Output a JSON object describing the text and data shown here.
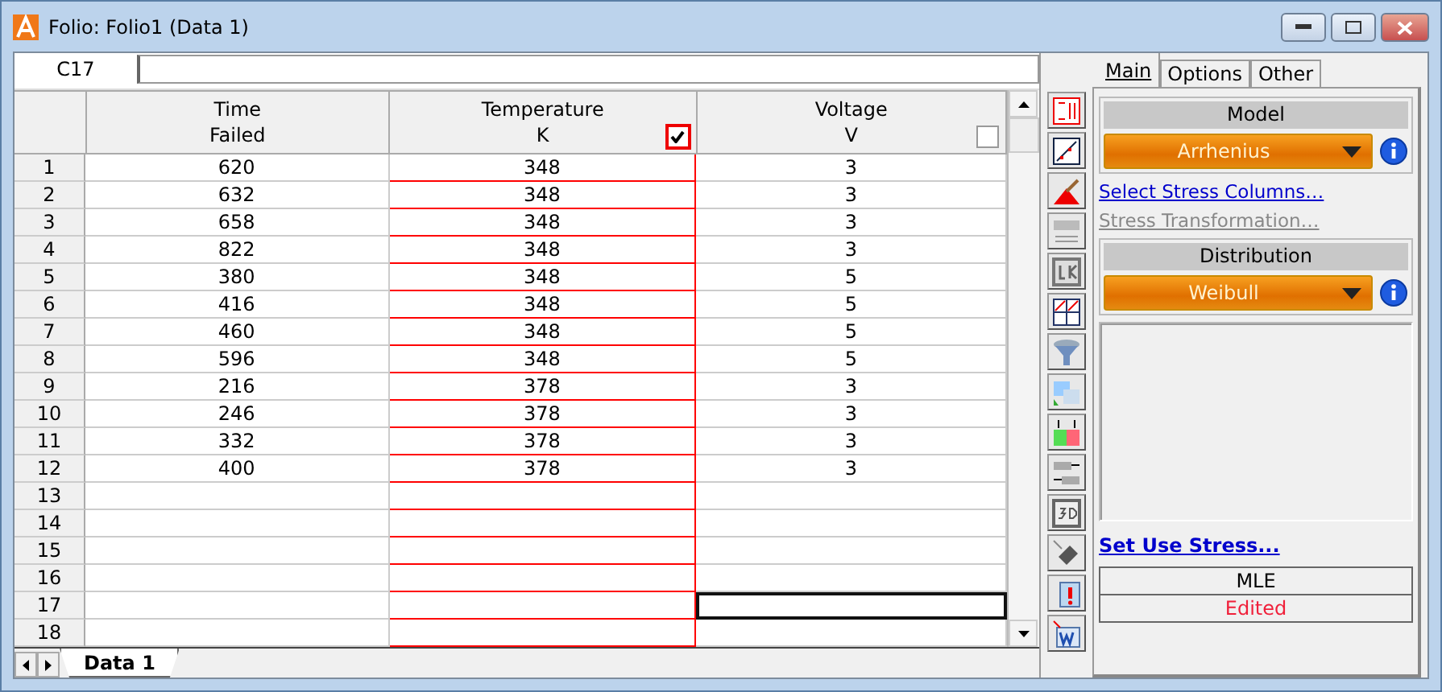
{
  "window": {
    "title": "Folio: Folio1 (Data 1)"
  },
  "cell_ref": "C17",
  "columns": [
    {
      "line1": "Time",
      "line2": "Failed"
    },
    {
      "line1": "Temperature",
      "line2": "K",
      "checked": true
    },
    {
      "line1": "Voltage",
      "line2": "V",
      "checked": false
    }
  ],
  "rows": [
    {
      "number": "1",
      "cells": [
        {
          "value": "620",
          "selected": false
        },
        {
          "value": "348",
          "selected": false
        },
        {
          "value": "3",
          "selected": false
        }
      ]
    },
    {
      "number": "2",
      "cells": [
        {
          "value": "632",
          "selected": false
        },
        {
          "value": "348",
          "selected": false
        },
        {
          "value": "3",
          "selected": false
        }
      ]
    },
    {
      "number": "3",
      "cells": [
        {
          "value": "658",
          "selected": false
        },
        {
          "value": "348",
          "selected": false
        },
        {
          "value": "3",
          "selected": false
        }
      ]
    },
    {
      "number": "4",
      "cells": [
        {
          "value": "822",
          "selected": false
        },
        {
          "value": "348",
          "selected": false
        },
        {
          "value": "3",
          "selected": false
        }
      ]
    },
    {
      "number": "5",
      "cells": [
        {
          "value": "380",
          "selected": false
        },
        {
          "value": "348",
          "selected": false
        },
        {
          "value": "5",
          "selected": false
        }
      ]
    },
    {
      "number": "6",
      "cells": [
        {
          "value": "416",
          "selected": false
        },
        {
          "value": "348",
          "selected": false
        },
        {
          "value": "5",
          "selected": false
        }
      ]
    },
    {
      "number": "7",
      "cells": [
        {
          "value": "460",
          "selected": false
        },
        {
          "value": "348",
          "selected": false
        },
        {
          "value": "5",
          "selected": false
        }
      ]
    },
    {
      "number": "8",
      "cells": [
        {
          "value": "596",
          "selected": false
        },
        {
          "value": "348",
          "selected": false
        },
        {
          "value": "5",
          "selected": false
        }
      ]
    },
    {
      "number": "9",
      "cells": [
        {
          "value": "216",
          "selected": false
        },
        {
          "value": "378",
          "selected": false
        },
        {
          "value": "3",
          "selected": false
        }
      ]
    },
    {
      "number": "10",
      "cells": [
        {
          "value": "246",
          "selected": false
        },
        {
          "value": "378",
          "selected": false
        },
        {
          "value": "3",
          "selected": false
        }
      ]
    },
    {
      "number": "11",
      "cells": [
        {
          "value": "332",
          "selected": false
        },
        {
          "value": "378",
          "selected": false
        },
        {
          "value": "3",
          "selected": false
        }
      ]
    },
    {
      "number": "12",
      "cells": [
        {
          "value": "400",
          "selected": false
        },
        {
          "value": "378",
          "selected": false
        },
        {
          "value": "3",
          "selected": false
        }
      ]
    },
    {
      "number": "13",
      "cells": [
        {
          "selected": false
        },
        {
          "selected": false
        },
        {
          "selected": false
        }
      ]
    },
    {
      "number": "14",
      "cells": [
        {
          "selected": false
        },
        {
          "selected": false
        },
        {
          "selected": false
        }
      ]
    },
    {
      "number": "15",
      "cells": [
        {
          "selected": false
        },
        {
          "selected": false
        },
        {
          "selected": false
        }
      ]
    },
    {
      "number": "16",
      "cells": [
        {
          "selected": false
        },
        {
          "selected": false
        },
        {
          "selected": false
        }
      ]
    },
    {
      "number": "17",
      "cells": [
        {
          "selected": false
        },
        {
          "selected": false
        },
        {
          "selected": true
        }
      ]
    },
    {
      "number": "18",
      "cells": [
        {
          "selected": false
        },
        {
          "selected": false
        },
        {
          "selected": false
        }
      ]
    }
  ],
  "sheet_tabs": [
    {
      "label": "Data 1",
      "selected": true
    }
  ],
  "panel_tabs": [
    {
      "label": "Main",
      "selected": true
    },
    {
      "label": "Options",
      "selected": false
    },
    {
      "label": "Other",
      "selected": false
    }
  ],
  "model": {
    "label": "Model",
    "value": "Arrhenius"
  },
  "links": [
    {
      "label": "Select Stress Columns…",
      "disabled": false
    },
    {
      "label": "Stress Transformation…",
      "disabled": true
    }
  ],
  "distribution": {
    "label": "Distribution",
    "value": "Weibull"
  },
  "use_stress_link": "Set Use Stress...",
  "status": [
    {
      "text": "MLE",
      "kind": "normal"
    },
    {
      "text": "Edited",
      "kind": "alert"
    }
  ]
}
